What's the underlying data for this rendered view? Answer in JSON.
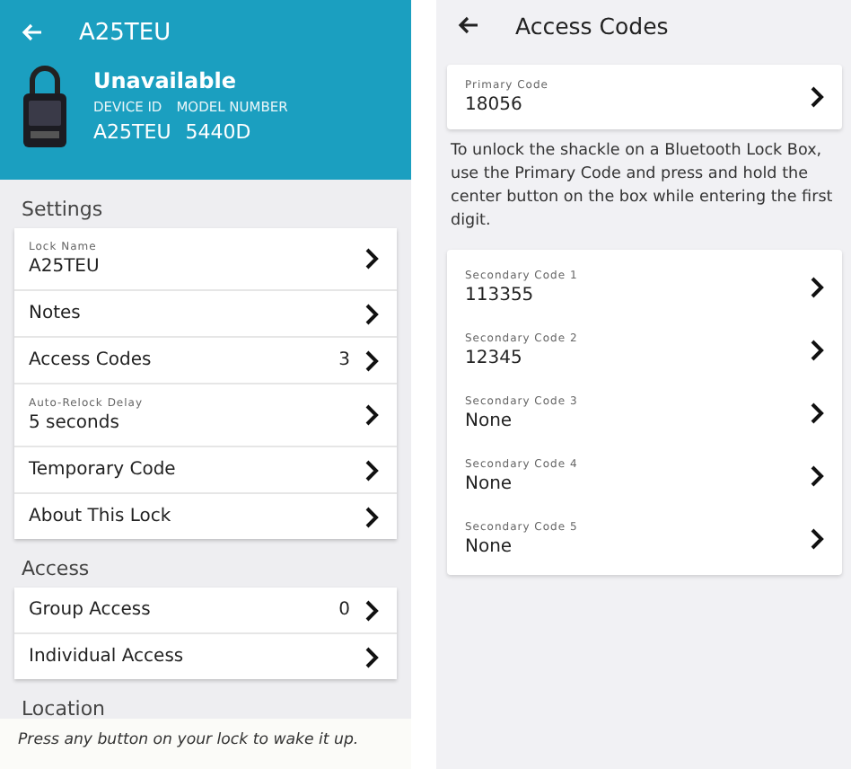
{
  "lock_screen": {
    "title": "A25TEU",
    "status": "Unavailable",
    "id_label": "DEVICE ID",
    "model_label": "MODEL NUMBER",
    "device_id": "A25TEU",
    "model_number": "5440D",
    "sections": [
      {
        "heading": "Settings",
        "rows": [
          {
            "caption": "Lock Name",
            "text": "A25TEU"
          },
          {
            "text": "Notes"
          },
          {
            "text": "Access Codes",
            "count": "3"
          },
          {
            "caption": "Auto-Relock Delay",
            "text": "5 seconds"
          },
          {
            "text": "Temporary Code"
          },
          {
            "text": "About This Lock"
          }
        ]
      },
      {
        "heading": "Access",
        "rows": [
          {
            "text": "Group Access",
            "count": "0"
          },
          {
            "text": "Individual Access"
          }
        ]
      },
      {
        "heading": "Location"
      }
    ],
    "toast": "Press any button on your lock to wake it up."
  },
  "codes_screen": {
    "title": "Access Codes",
    "primary": {
      "caption": "Primary Code",
      "value": "18056"
    },
    "note": "To unlock the shackle on a Bluetooth Lock Box, use the Primary Code and press and hold the center button on the box while entering the first digit.",
    "codes": [
      {
        "caption": "Secondary Code 1",
        "value": "113355"
      },
      {
        "caption": "Secondary Code 2",
        "value": "12345"
      },
      {
        "caption": "Secondary Code 3",
        "value": "None"
      },
      {
        "caption": "Secondary Code 4",
        "value": "None"
      },
      {
        "caption": "Secondary Code 5",
        "value": "None"
      }
    ]
  }
}
